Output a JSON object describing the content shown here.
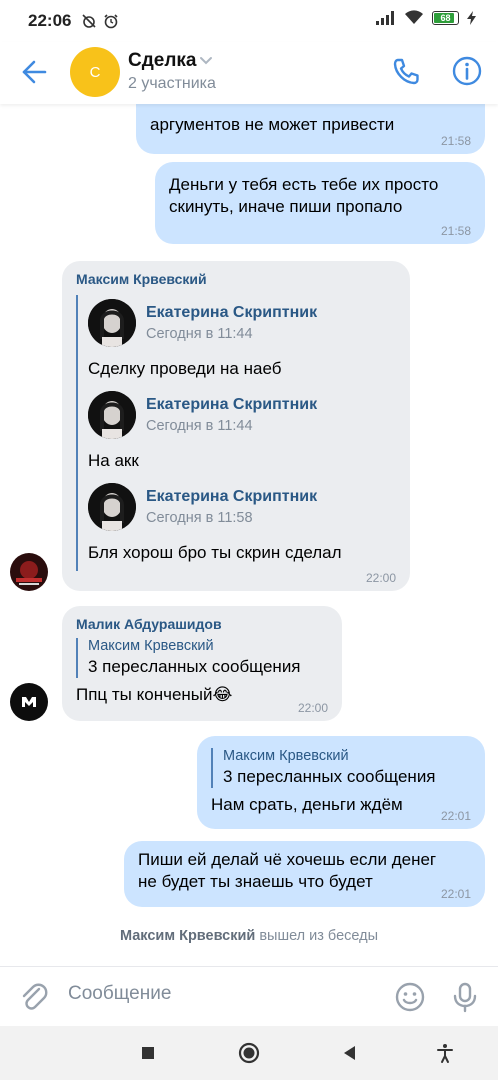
{
  "status_bar": {
    "time": "22:06",
    "battery": "68"
  },
  "header": {
    "avatar_letter": "С",
    "title": "Сделка",
    "subtitle": "2 участника"
  },
  "messages": {
    "m1": {
      "text": "аргументов не может привести",
      "time": "21:58"
    },
    "m2": {
      "line1": "Деньги у тебя есть тебе их просто",
      "line2": "скинуть, иначе пиши пропало",
      "time": "21:58"
    },
    "m3": {
      "author": "Максим Крвевский",
      "time": "22:00",
      "forwards": [
        {
          "name": "Екатерина Скриптник",
          "when": "Сегодня в 11:44",
          "text": "Сделку проведи на наеб"
        },
        {
          "name": "Екатерина Скриптник",
          "when": "Сегодня в 11:44",
          "text": "На акк"
        },
        {
          "name": "Екатерина Скриптник",
          "when": "Сегодня в 11:58",
          "text": "Бля хорош бро ты скрин сделал"
        }
      ]
    },
    "m4": {
      "author": "Малик Абдурашидов",
      "reply_author": "Максим Крвевский",
      "reply_text": "3 пересланных сообщения",
      "text": "Ппц ты конченый",
      "emoji": "😂",
      "time": "22:00"
    },
    "m5": {
      "reply_author": "Максим Крвевский",
      "reply_text": "3 пересланных сообщения",
      "text": "Нам срать, деньги ждём",
      "time": "22:01"
    },
    "m6": {
      "line1": "Пиши ей делай чё хочешь если денег",
      "line2": "не будет ты знаешь что будет",
      "time": "22:01"
    },
    "service": {
      "name": "Максим Крвевский",
      "action": "вышел из беседы"
    }
  },
  "composer": {
    "placeholder": "Сообщение"
  },
  "colors": {
    "outgoing_bubble": "#cce4ff",
    "incoming_bubble": "#ebedf0",
    "accent": "#2a5885",
    "icon_blue": "#3f8ae0",
    "chat_avatar": "#f8c21a"
  },
  "icons": [
    "alarm-off-icon",
    "alarm-icon",
    "signal-icon",
    "wifi-icon",
    "battery-icon",
    "charging-icon",
    "back-arrow-icon",
    "chevron-down-icon",
    "phone-icon",
    "info-icon",
    "paperclip-icon",
    "emoji-icon",
    "microphone-icon",
    "nav-recents-icon",
    "nav-home-icon",
    "nav-back-icon",
    "accessibility-icon"
  ]
}
